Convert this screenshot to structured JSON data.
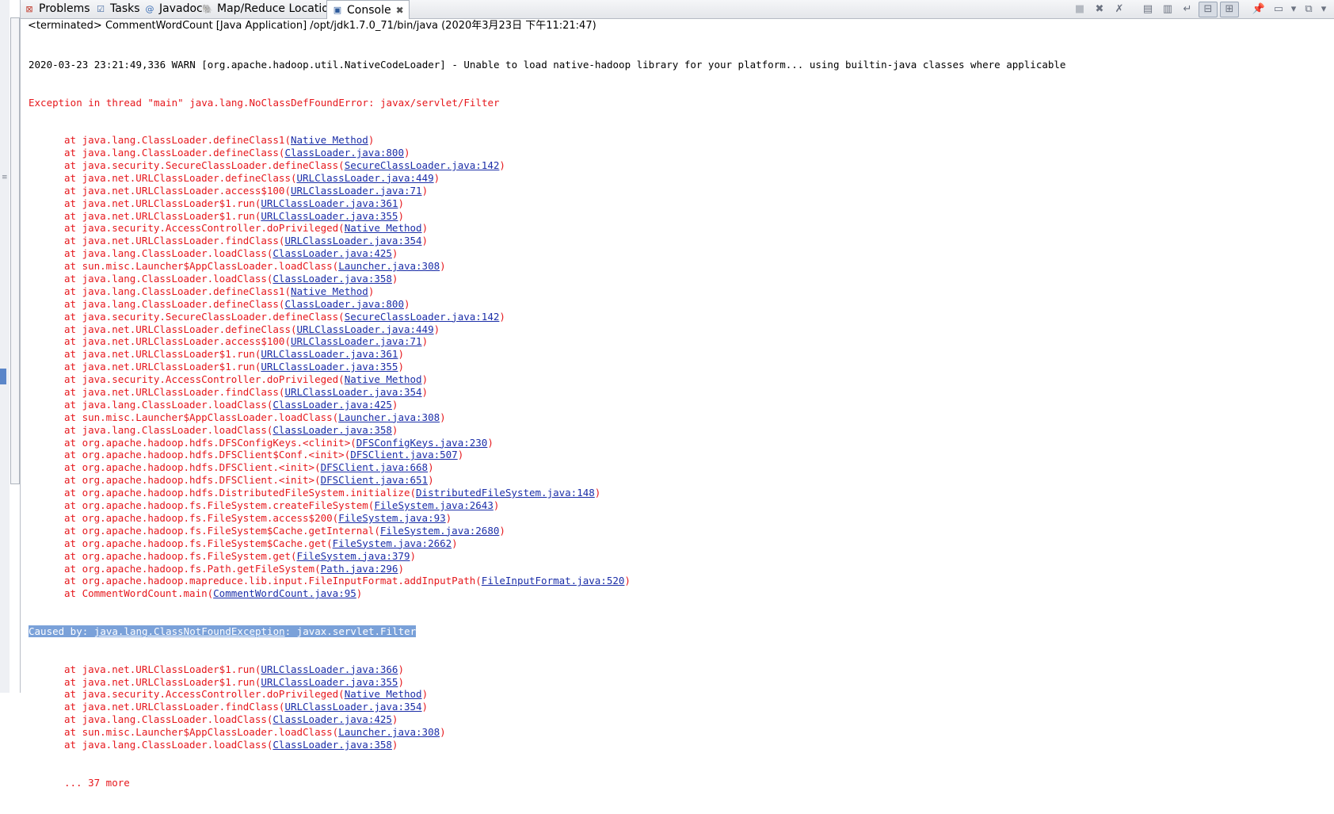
{
  "tabs": [
    {
      "label": "Problems",
      "icon": "problems-icon"
    },
    {
      "label": "Tasks",
      "icon": "tasks-icon"
    },
    {
      "label": "Javadoc",
      "icon": "javadoc-icon"
    },
    {
      "label": "Map/Reduce Locations",
      "icon": "map-reduce-icon"
    },
    {
      "label": "Console",
      "icon": "console-icon",
      "close": "✖"
    }
  ],
  "toolbar": [
    "terminate-icon",
    "remove-launch-icon",
    "remove-all-terminated-icon",
    "clear-console-icon",
    "scroll-lock-icon",
    "word-wrap-icon",
    "show-stdout-icon",
    "show-stderr-icon",
    "pin-console-icon",
    "display-console-icon",
    "open-console-icon",
    "view-menu-icon"
  ],
  "status": "<terminated> CommentWordCount [Java Application] /opt/jdk1.7.0_71/bin/java (2020年3月23日 下午11:21:47)",
  "console": {
    "warn_line": "2020-03-23 23:21:49,336 WARN [org.apache.hadoop.util.NativeCodeLoader] - Unable to load native-hadoop library for your platform... using builtin-java classes where applicable",
    "exception_line": "Exception in thread \"main\" java.lang.NoClassDefFoundError: javax/servlet/Filter",
    "trace1": [
      {
        "m": "at java.lang.ClassLoader.defineClass1(",
        "l": "Native Method"
      },
      {
        "m": "at java.lang.ClassLoader.defineClass(",
        "l": "ClassLoader.java:800"
      },
      {
        "m": "at java.security.SecureClassLoader.defineClass(",
        "l": "SecureClassLoader.java:142"
      },
      {
        "m": "at java.net.URLClassLoader.defineClass(",
        "l": "URLClassLoader.java:449"
      },
      {
        "m": "at java.net.URLClassLoader.access$100(",
        "l": "URLClassLoader.java:71"
      },
      {
        "m": "at java.net.URLClassLoader$1.run(",
        "l": "URLClassLoader.java:361"
      },
      {
        "m": "at java.net.URLClassLoader$1.run(",
        "l": "URLClassLoader.java:355"
      },
      {
        "m": "at java.security.AccessController.doPrivileged(",
        "l": "Native Method"
      },
      {
        "m": "at java.net.URLClassLoader.findClass(",
        "l": "URLClassLoader.java:354"
      },
      {
        "m": "at java.lang.ClassLoader.loadClass(",
        "l": "ClassLoader.java:425"
      },
      {
        "m": "at sun.misc.Launcher$AppClassLoader.loadClass(",
        "l": "Launcher.java:308"
      },
      {
        "m": "at java.lang.ClassLoader.loadClass(",
        "l": "ClassLoader.java:358"
      },
      {
        "m": "at java.lang.ClassLoader.defineClass1(",
        "l": "Native Method"
      },
      {
        "m": "at java.lang.ClassLoader.defineClass(",
        "l": "ClassLoader.java:800"
      },
      {
        "m": "at java.security.SecureClassLoader.defineClass(",
        "l": "SecureClassLoader.java:142"
      },
      {
        "m": "at java.net.URLClassLoader.defineClass(",
        "l": "URLClassLoader.java:449"
      },
      {
        "m": "at java.net.URLClassLoader.access$100(",
        "l": "URLClassLoader.java:71"
      },
      {
        "m": "at java.net.URLClassLoader$1.run(",
        "l": "URLClassLoader.java:361"
      },
      {
        "m": "at java.net.URLClassLoader$1.run(",
        "l": "URLClassLoader.java:355"
      },
      {
        "m": "at java.security.AccessController.doPrivileged(",
        "l": "Native Method"
      },
      {
        "m": "at java.net.URLClassLoader.findClass(",
        "l": "URLClassLoader.java:354"
      },
      {
        "m": "at java.lang.ClassLoader.loadClass(",
        "l": "ClassLoader.java:425"
      },
      {
        "m": "at sun.misc.Launcher$AppClassLoader.loadClass(",
        "l": "Launcher.java:308"
      },
      {
        "m": "at java.lang.ClassLoader.loadClass(",
        "l": "ClassLoader.java:358"
      },
      {
        "m": "at org.apache.hadoop.hdfs.DFSConfigKeys.<clinit>(",
        "l": "DFSConfigKeys.java:230"
      },
      {
        "m": "at org.apache.hadoop.hdfs.DFSClient$Conf.<init>(",
        "l": "DFSClient.java:507"
      },
      {
        "m": "at org.apache.hadoop.hdfs.DFSClient.<init>(",
        "l": "DFSClient.java:668"
      },
      {
        "m": "at org.apache.hadoop.hdfs.DFSClient.<init>(",
        "l": "DFSClient.java:651"
      },
      {
        "m": "at org.apache.hadoop.hdfs.DistributedFileSystem.initialize(",
        "l": "DistributedFileSystem.java:148"
      },
      {
        "m": "at org.apache.hadoop.fs.FileSystem.createFileSystem(",
        "l": "FileSystem.java:2643"
      },
      {
        "m": "at org.apache.hadoop.fs.FileSystem.access$200(",
        "l": "FileSystem.java:93"
      },
      {
        "m": "at org.apache.hadoop.fs.FileSystem$Cache.getInternal(",
        "l": "FileSystem.java:2680"
      },
      {
        "m": "at org.apache.hadoop.fs.FileSystem$Cache.get(",
        "l": "FileSystem.java:2662"
      },
      {
        "m": "at org.apache.hadoop.fs.FileSystem.get(",
        "l": "FileSystem.java:379"
      },
      {
        "m": "at org.apache.hadoop.fs.Path.getFileSystem(",
        "l": "Path.java:296"
      },
      {
        "m": "at org.apache.hadoop.mapreduce.lib.input.FileInputFormat.addInputPath(",
        "l": "FileInputFormat.java:520"
      },
      {
        "m": "at CommentWordCount.main(",
        "l": "CommentWordCount.java:95"
      }
    ],
    "caused_prefix": "Caused by: ",
    "caused_link": "java.lang.ClassNotFoundException",
    "caused_suffix": ": javax.servlet.Filter",
    "trace2": [
      {
        "m": "at java.net.URLClassLoader$1.run(",
        "l": "URLClassLoader.java:366"
      },
      {
        "m": "at java.net.URLClassLoader$1.run(",
        "l": "URLClassLoader.java:355"
      },
      {
        "m": "at java.security.AccessController.doPrivileged(",
        "l": "Native Method"
      },
      {
        "m": "at java.net.URLClassLoader.findClass(",
        "l": "URLClassLoader.java:354"
      },
      {
        "m": "at java.lang.ClassLoader.loadClass(",
        "l": "ClassLoader.java:425"
      },
      {
        "m": "at sun.misc.Launcher$AppClassLoader.loadClass(",
        "l": "Launcher.java:308"
      },
      {
        "m": "at java.lang.ClassLoader.loadClass(",
        "l": "ClassLoader.java:358"
      }
    ],
    "more": "... 37 more"
  }
}
